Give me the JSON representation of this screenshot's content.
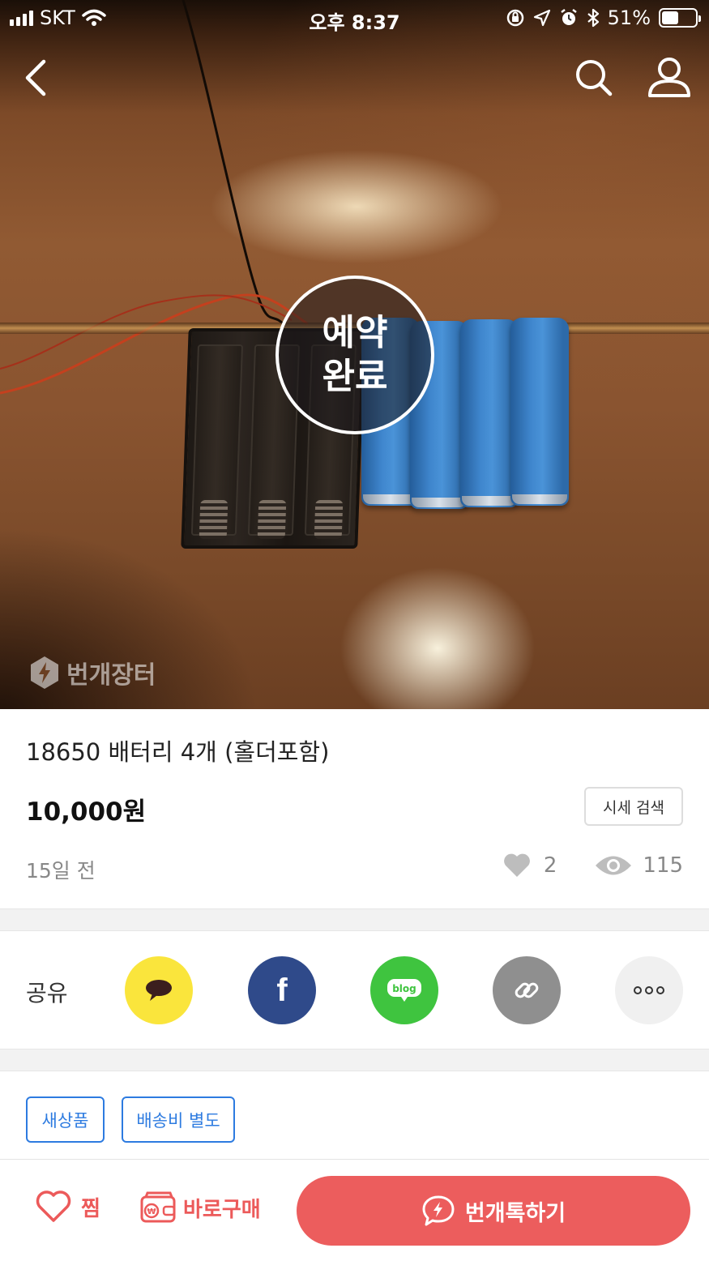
{
  "status_bar": {
    "carrier": "SKT",
    "time": "오후 8:37",
    "battery_percent": "51%",
    "battery_level": 0.51
  },
  "nav": {
    "back_icon": "chevron-left-icon",
    "search_icon": "search-icon",
    "profile_icon": "user-icon"
  },
  "photo": {
    "status_line1": "예약",
    "status_line2": "완료",
    "watermark": "번개장터"
  },
  "product": {
    "title": "18650 배터리 4개 (홀더포함)",
    "price": "10,000원",
    "market_search_label": "시세 검색",
    "posted_ago": "15일 전",
    "likes": "2",
    "views": "115"
  },
  "share": {
    "label": "공유",
    "buttons": [
      {
        "name": "kakaotalk",
        "icon": "speech-bubble-icon",
        "color": "#fae53c"
      },
      {
        "name": "facebook",
        "icon": "facebook-icon",
        "glyph": "f",
        "color": "#2f4a8a"
      },
      {
        "name": "blog",
        "icon": "blog-icon",
        "glyph": "blog",
        "color": "#3fc43f"
      },
      {
        "name": "copy-link",
        "icon": "link-icon",
        "color": "#8f8f8f"
      },
      {
        "name": "more",
        "icon": "more-icon",
        "glyph": "∘∘∘",
        "color": "#f0f0f0"
      }
    ]
  },
  "tags": [
    "새상품",
    "배송비 별도"
  ],
  "bottom_bar": {
    "like_label": "찜",
    "buy_now_label": "바로구매",
    "chat_label": "번개톡하기",
    "accent_color": "#ec5d5d"
  }
}
